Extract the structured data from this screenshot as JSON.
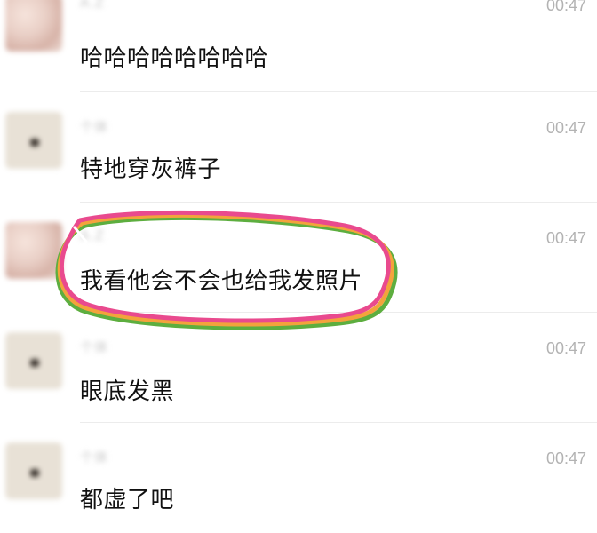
{
  "messages": [
    {
      "sender": "A.Z",
      "time": "00:47",
      "text": "哈哈哈哈哈哈哈哈",
      "avatar": "pink"
    },
    {
      "sender": "个体",
      "time": "00:47",
      "text": "特地穿灰裤子",
      "avatar": "grey"
    },
    {
      "sender": "A.Z",
      "time": "00:47",
      "text": "我看他会不会也给我发照片",
      "avatar": "pink",
      "highlighted": true
    },
    {
      "sender": "个体",
      "time": "00:47",
      "text": "眼底发黑",
      "avatar": "grey"
    },
    {
      "sender": "个体",
      "time": "00:47",
      "text": "都虚了吧",
      "avatar": "grey"
    }
  ],
  "highlight_colors": [
    "#e94a8e",
    "#f3a33c",
    "#5dae3f"
  ]
}
